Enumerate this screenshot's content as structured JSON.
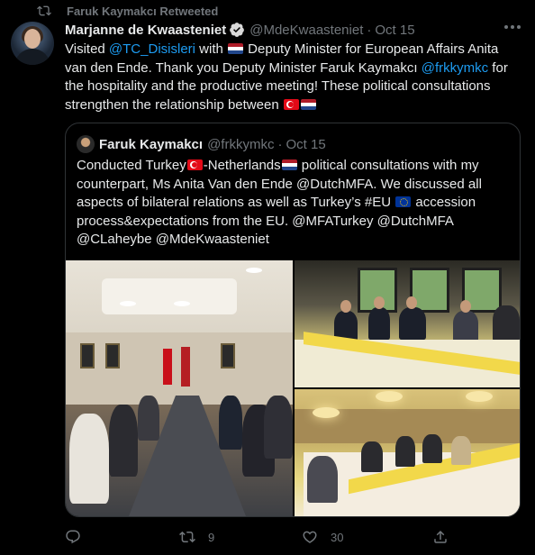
{
  "retweet": {
    "label": "Faruk Kaymakcı Retweeted"
  },
  "tweet": {
    "author_name": "Marjanne de Kwaasteniet",
    "author_handle": "@MdeKwaasteniet",
    "separator": "·",
    "time": "Oct 15",
    "text": {
      "t1": "Visited ",
      "mention_mfa": "@TC_Disisleri",
      "t2": " with ",
      "t3": " Deputy Minister for European Affairs Anita van den Ende. Thank you Deputy Minister Faruk Kaymakcı ",
      "mention_fk": "@frkkymkc",
      "t4": " for the hospitality and the productive meeting! These political consultations strengthen the relationship between "
    }
  },
  "quote": {
    "author_name": "Faruk Kaymakcı",
    "author_handle": "@frkkymkc",
    "separator": "·",
    "time": "Oct 15",
    "text": {
      "t1": "Conducted Turkey",
      "t2": "-Netherlands",
      "t3": " political consultations with my counterpart, Ms Anita Van den Ende @DutchMFA. We discussed all aspects of bilateral relations as well as Turkey’s #EU ",
      "t4": " accession process&expectations from the EU. @MFATurkey @DutchMFA @CLaheybe @MdeKwaasteniet"
    }
  },
  "actions": {
    "reply_count": "",
    "retweet_count": "9",
    "like_count": "30"
  },
  "icons": {
    "retweet_bar": "retweet-icon",
    "verified": "verified-badge-icon",
    "more": "more-icon",
    "reply": "reply-icon",
    "retweet": "retweet-icon",
    "like": "heart-icon",
    "share": "share-icon"
  },
  "colors": {
    "background": "#000000",
    "text": "#e7e9ea",
    "muted": "#71767b",
    "link": "#1d9bf0",
    "border": "#2f3336"
  }
}
